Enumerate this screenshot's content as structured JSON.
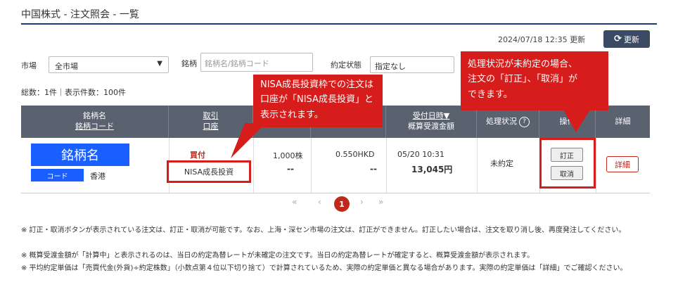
{
  "page": {
    "title": "中国株式 - 注文照会 - 一覧"
  },
  "toolbar": {
    "timestamp": "2024/07/18 12:35 更新",
    "refresh_label": "更新"
  },
  "filters": {
    "market_label": "市場",
    "market_value": "全市場",
    "stock_label": "銘柄",
    "stock_placeholder": "銘柄名/銘柄コード",
    "status_label": "約定状態",
    "status_value": "指定なし"
  },
  "summary": "総数：1件｜表示件数：100件",
  "table": {
    "headers": {
      "stock": "銘柄名",
      "code": "銘柄コード",
      "trade": "取引",
      "account": "口座",
      "date": "受付日時▼",
      "settle": "概算受渡金額",
      "process": "処理状況",
      "help": "?",
      "ops": "操作",
      "detail": "詳細"
    },
    "rows": [
      {
        "stock_name": "銘柄名",
        "code": "コード",
        "market": "香港",
        "trade": "買付",
        "account": "NISA成長投資",
        "qty": "1,000株",
        "qty_sub": "--",
        "price": "0.550HKD",
        "price_sub": "--",
        "date": "05/20 10:31",
        "amount": "13,045円",
        "status": "未約定",
        "correct_label": "訂正",
        "cancel_label": "取消",
        "detail_label": "詳細"
      }
    ]
  },
  "pagination": {
    "first": "«",
    "prev": "‹",
    "current": "1",
    "next": "›",
    "last": "»"
  },
  "callouts": {
    "nisa": [
      "NISA成長投資枠での注文は",
      "口座が「NISA成長投資」と",
      "表示されます。"
    ],
    "status": [
      "処理状況が未約定の場合、",
      "注文の「訂正」、「取消」が",
      "できます。"
    ]
  },
  "notes": [
    "※ 訂正・取消ボタンが表示されている注文は、訂正・取消が可能です。なお、上海・深セン市場の注文は、訂正ができません。訂正したい場合は、注文を取り消し後、再度発注してください。",
    "※ 概算受渡金額が「計算中」と表示されるのは、当日の約定為替レートが未確定の注文です。当日の約定為替レートが確定すると、概算受渡金額が表示されます。",
    "※ 平均約定単価は「売買代金(外貨)÷約定株数」（小数点第４位以下切り捨て）で計算されているため、実際の約定単価と異なる場合があります。実際の約定単価は「詳細」でご確認ください。"
  ],
  "colors": {
    "accent_red": "#d71c1c",
    "header_bg": "#5a6270",
    "stock_blue": "#1a5fff"
  }
}
